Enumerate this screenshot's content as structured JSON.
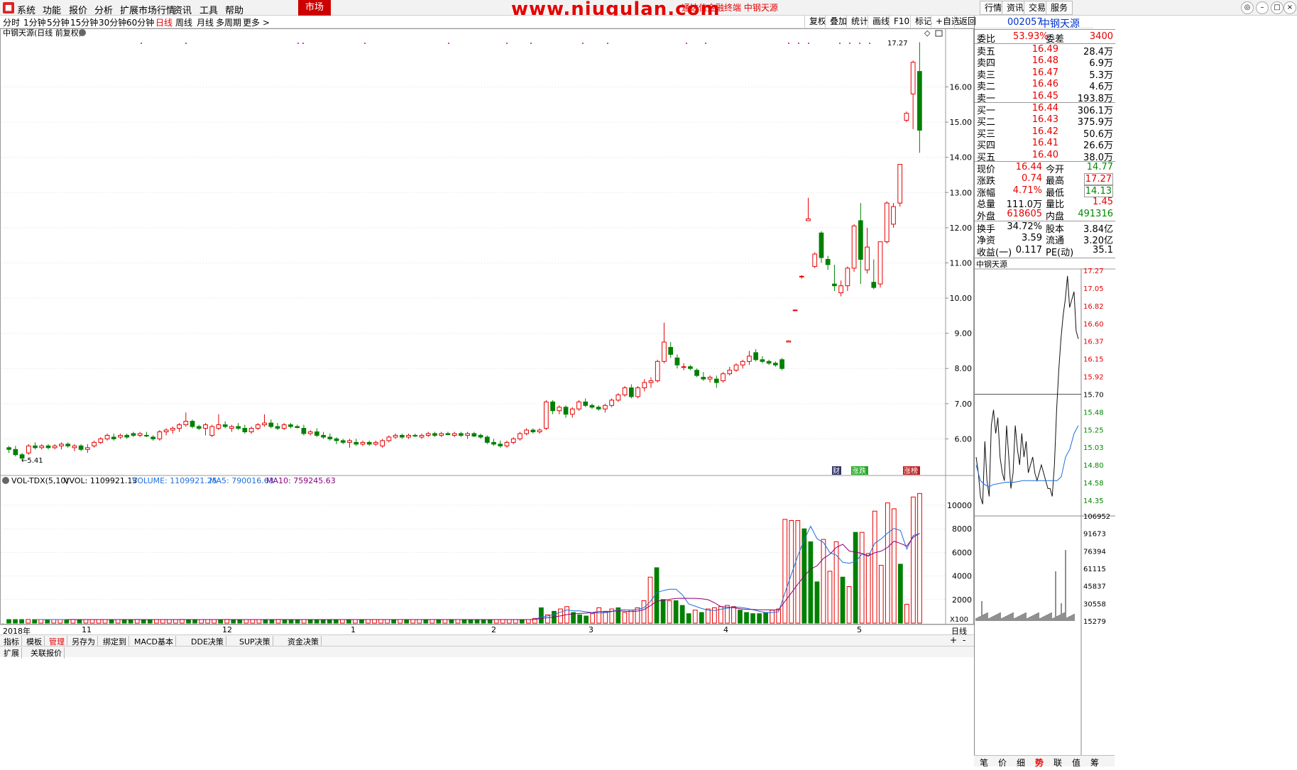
{
  "menu": {
    "items": [
      "系统",
      "功能",
      "报价",
      "分析",
      "扩展市场行情",
      "资讯",
      "工具",
      "帮助"
    ],
    "market_tab": "市场",
    "watermark": "www.niugulan.com",
    "watermark_sub": "通达信金融终端 中钢天源",
    "right_buttons": [
      "行情",
      "资讯",
      "交易",
      "服务"
    ]
  },
  "periods": {
    "items": [
      "分时",
      "1分钟",
      "5分钟",
      "15分钟",
      "30分钟",
      "60分钟",
      "日线",
      "周线",
      "月线",
      "多周期",
      "更多 >"
    ],
    "active": "日线",
    "tools": [
      "复权",
      "叠加",
      "统计",
      "画线",
      "F10",
      "标记",
      "+自选",
      "返回"
    ]
  },
  "chart": {
    "header": "中钢天源(日线 前复权)",
    "last_time": "17.27",
    "low_label": "5.41",
    "markers": [
      "财",
      "涨跌",
      "涨榜"
    ],
    "vol_header": {
      "indicator": "VOL-TDX(5,10)",
      "vvol": "VVOL: 1109921.13",
      "volume": "VOLUME: 1109921.25",
      "ma5": "MA5: 790016.63",
      "ma10": "MA10: 759245.63"
    },
    "x_labels": [
      "2018年",
      "11",
      "12",
      "1",
      "2",
      "3",
      "4",
      "5"
    ],
    "period_label": "日线",
    "x100": "X100",
    "colors": {
      "up": "#e60000",
      "down": "#008000",
      "ma5": "#1e6fdc",
      "ma10": "#8b0080"
    }
  },
  "chart_data": [
    {
      "type": "candlestick",
      "title": "中钢天源(日线 前复权)",
      "ylim": [
        5.0,
        17.3
      ],
      "y_ticks": [
        "6.00",
        "7.00",
        "8.00",
        "9.00",
        "10.00",
        "11.00",
        "12.00",
        "13.00",
        "14.00",
        "15.00",
        "16.00"
      ],
      "x_labels": [
        "2018年",
        "11",
        "12",
        "1",
        "2",
        "3",
        "4",
        "5"
      ],
      "ohlc": [
        [
          5.75,
          5.8,
          5.6,
          5.7
        ],
        [
          5.7,
          5.8,
          5.5,
          5.55
        ],
        [
          5.55,
          5.6,
          5.41,
          5.45
        ],
        [
          5.6,
          5.85,
          5.55,
          5.8
        ],
        [
          5.8,
          5.9,
          5.7,
          5.75
        ],
        [
          5.75,
          5.85,
          5.7,
          5.8
        ],
        [
          5.8,
          5.85,
          5.7,
          5.75
        ],
        [
          5.75,
          5.85,
          5.7,
          5.8
        ],
        [
          5.8,
          5.9,
          5.7,
          5.85
        ],
        [
          5.85,
          5.9,
          5.75,
          5.8
        ],
        [
          5.75,
          5.85,
          5.65,
          5.8
        ],
        [
          5.8,
          5.85,
          5.65,
          5.7
        ],
        [
          5.7,
          5.85,
          5.6,
          5.75
        ],
        [
          5.8,
          5.95,
          5.75,
          5.9
        ],
        [
          5.9,
          6.05,
          5.85,
          6.0
        ],
        [
          6.0,
          6.15,
          5.95,
          6.1
        ],
        [
          6.05,
          6.15,
          5.95,
          6.0
        ],
        [
          6.05,
          6.15,
          6.0,
          6.1
        ],
        [
          6.1,
          6.15,
          6.0,
          6.05
        ],
        [
          6.15,
          6.2,
          6.05,
          6.1
        ],
        [
          6.1,
          6.2,
          6.05,
          6.15
        ],
        [
          6.1,
          6.2,
          6.05,
          6.08
        ],
        [
          6.05,
          6.1,
          5.95,
          6.0
        ],
        [
          6.0,
          6.25,
          5.95,
          6.2
        ],
        [
          6.2,
          6.3,
          6.1,
          6.25
        ],
        [
          6.25,
          6.35,
          6.15,
          6.3
        ],
        [
          6.3,
          6.45,
          6.2,
          6.4
        ],
        [
          6.4,
          6.75,
          6.35,
          6.5
        ],
        [
          6.5,
          6.55,
          6.3,
          6.35
        ],
        [
          6.35,
          6.4,
          6.25,
          6.3
        ],
        [
          6.3,
          6.45,
          6.1,
          6.4
        ],
        [
          6.1,
          6.4,
          6.05,
          6.35
        ],
        [
          6.3,
          6.7,
          6.25,
          6.4
        ],
        [
          6.4,
          6.5,
          6.3,
          6.35
        ],
        [
          6.3,
          6.4,
          6.2,
          6.35
        ],
        [
          6.35,
          6.45,
          6.25,
          6.3
        ],
        [
          6.3,
          6.4,
          6.15,
          6.2
        ],
        [
          6.2,
          6.35,
          6.15,
          6.3
        ],
        [
          6.3,
          6.45,
          6.25,
          6.4
        ],
        [
          6.4,
          6.7,
          6.35,
          6.45
        ],
        [
          6.45,
          6.55,
          6.3,
          6.35
        ],
        [
          6.35,
          6.45,
          6.25,
          6.3
        ],
        [
          6.3,
          6.45,
          6.25,
          6.4
        ],
        [
          6.4,
          6.45,
          6.3,
          6.35
        ],
        [
          6.35,
          6.4,
          6.3,
          6.32
        ],
        [
          6.3,
          6.4,
          6.1,
          6.15
        ],
        [
          6.15,
          6.25,
          6.1,
          6.2
        ],
        [
          6.2,
          6.3,
          6.05,
          6.1
        ],
        [
          6.1,
          6.2,
          6.0,
          6.05
        ],
        [
          6.05,
          6.15,
          5.95,
          6.0
        ],
        [
          6.0,
          6.05,
          5.85,
          5.95
        ],
        [
          5.95,
          6.0,
          5.85,
          5.9
        ],
        [
          5.9,
          6.0,
          5.75,
          5.95
        ],
        [
          5.9,
          6.0,
          5.8,
          5.85
        ],
        [
          5.85,
          5.95,
          5.8,
          5.9
        ],
        [
          5.9,
          5.95,
          5.8,
          5.85
        ],
        [
          5.85,
          5.95,
          5.8,
          5.9
        ],
        [
          5.8,
          6.0,
          5.75,
          5.95
        ],
        [
          5.95,
          6.1,
          5.9,
          6.05
        ],
        [
          6.05,
          6.15,
          6.0,
          6.1
        ],
        [
          6.1,
          6.15,
          6.0,
          6.05
        ],
        [
          6.05,
          6.15,
          6.0,
          6.1
        ],
        [
          6.1,
          6.15,
          6.05,
          6.08
        ],
        [
          6.05,
          6.15,
          6.0,
          6.1
        ],
        [
          6.1,
          6.2,
          6.05,
          6.15
        ],
        [
          6.15,
          6.2,
          6.05,
          6.1
        ],
        [
          6.1,
          6.2,
          6.05,
          6.15
        ],
        [
          6.15,
          6.2,
          6.1,
          6.12
        ],
        [
          6.1,
          6.2,
          6.05,
          6.15
        ],
        [
          6.15,
          6.2,
          6.05,
          6.1
        ],
        [
          6.1,
          6.2,
          6.0,
          6.15
        ],
        [
          6.15,
          6.2,
          6.05,
          6.08
        ],
        [
          6.1,
          6.15,
          6.0,
          6.05
        ],
        [
          6.05,
          6.1,
          5.85,
          5.9
        ],
        [
          5.9,
          6.0,
          5.8,
          5.85
        ],
        [
          5.85,
          5.95,
          5.75,
          5.8
        ],
        [
          5.8,
          5.95,
          5.75,
          5.9
        ],
        [
          5.9,
          6.05,
          5.85,
          6.0
        ],
        [
          6.0,
          6.2,
          5.95,
          6.15
        ],
        [
          6.15,
          6.3,
          6.1,
          6.25
        ],
        [
          6.25,
          6.3,
          6.15,
          6.2
        ],
        [
          6.2,
          6.3,
          6.15,
          6.25
        ],
        [
          6.3,
          7.1,
          6.25,
          7.05
        ],
        [
          7.05,
          7.1,
          6.7,
          6.8
        ],
        [
          6.8,
          6.95,
          6.7,
          6.9
        ],
        [
          6.9,
          6.95,
          6.6,
          6.7
        ],
        [
          6.7,
          6.9,
          6.6,
          6.85
        ],
        [
          6.85,
          7.1,
          6.8,
          7.05
        ],
        [
          7.05,
          7.15,
          6.9,
          6.95
        ],
        [
          6.95,
          7.0,
          6.85,
          6.9
        ],
        [
          6.9,
          6.95,
          6.8,
          6.85
        ],
        [
          6.85,
          7.0,
          6.75,
          6.95
        ],
        [
          6.95,
          7.15,
          6.9,
          7.1
        ],
        [
          7.1,
          7.3,
          7.05,
          7.25
        ],
        [
          7.25,
          7.5,
          7.2,
          7.45
        ],
        [
          7.45,
          7.55,
          7.15,
          7.2
        ],
        [
          7.2,
          7.5,
          7.15,
          7.45
        ],
        [
          7.45,
          7.7,
          7.35,
          7.6
        ],
        [
          7.6,
          7.75,
          7.45,
          7.65
        ],
        [
          7.65,
          8.25,
          7.6,
          8.2
        ],
        [
          8.2,
          9.3,
          8.15,
          8.75
        ],
        [
          8.6,
          8.75,
          8.3,
          8.4
        ],
        [
          8.3,
          8.4,
          8.0,
          8.1
        ],
        [
          8.05,
          8.15,
          7.95,
          8.05
        ],
        [
          8.05,
          8.1,
          7.95,
          8.0
        ],
        [
          7.95,
          8.0,
          7.75,
          7.8
        ],
        [
          7.75,
          7.9,
          7.65,
          7.7
        ],
        [
          7.7,
          7.8,
          7.6,
          7.75
        ],
        [
          7.7,
          7.8,
          7.45,
          7.6
        ],
        [
          7.65,
          7.9,
          7.6,
          7.85
        ],
        [
          7.85,
          8.05,
          7.8,
          7.95
        ],
        [
          7.95,
          8.15,
          7.9,
          8.1
        ],
        [
          8.1,
          8.25,
          8.0,
          8.2
        ],
        [
          8.2,
          8.5,
          8.1,
          8.35
        ],
        [
          8.45,
          8.55,
          8.2,
          8.25
        ],
        [
          8.25,
          8.35,
          8.15,
          8.2
        ],
        [
          8.2,
          8.25,
          8.1,
          8.15
        ],
        [
          8.15,
          8.2,
          8.05,
          8.1
        ],
        [
          8.25,
          8.3,
          7.95,
          8.0
        ],
        [
          8.75,
          8.8,
          8.75,
          8.78
        ],
        [
          9.65,
          9.68,
          9.65,
          9.66
        ],
        [
          10.6,
          10.65,
          10.55,
          10.62
        ],
        [
          12.2,
          12.85,
          12.2,
          12.25
        ],
        [
          10.9,
          11.3,
          10.85,
          11.25
        ],
        [
          11.85,
          11.9,
          11.0,
          11.15
        ],
        [
          11.1,
          11.2,
          10.8,
          10.95
        ],
        [
          10.4,
          10.95,
          10.2,
          10.35
        ],
        [
          10.15,
          10.5,
          10.05,
          10.35
        ],
        [
          10.35,
          10.9,
          10.2,
          10.85
        ],
        [
          10.85,
          12.1,
          10.75,
          12.05
        ],
        [
          12.2,
          12.7,
          10.4,
          11.1
        ],
        [
          10.8,
          12.0,
          10.7,
          11.45
        ],
        [
          10.45,
          11.1,
          10.25,
          10.3
        ],
        [
          10.4,
          10.6,
          10.3,
          11.6
        ],
        [
          11.6,
          12.75,
          11.55,
          12.7
        ],
        [
          12.1,
          12.7,
          12.0,
          12.6
        ],
        [
          12.7,
          13.8,
          12.6,
          13.8
        ],
        [
          15.05,
          15.3,
          15.0,
          15.25
        ],
        [
          15.8,
          16.75,
          14.8,
          16.7
        ],
        [
          16.44,
          17.27,
          14.13,
          14.77
        ]
      ]
    },
    {
      "type": "bar",
      "title": "VOL-TDX(5,10)",
      "ylim": [
        0,
        11000
      ],
      "y_ticks": [
        "2000",
        "4000",
        "6000",
        "8000",
        "10000"
      ],
      "series": [
        {
          "name": "VOLUME",
          "values": [
            300,
            300,
            300,
            310,
            300,
            300,
            300,
            300,
            300,
            300,
            310,
            300,
            300,
            300,
            300,
            300,
            300,
            300,
            300,
            300,
            310,
            300,
            300,
            300,
            300,
            300,
            300,
            310,
            300,
            300,
            300,
            300,
            300,
            300,
            310,
            300,
            300,
            300,
            300,
            300,
            300,
            300,
            310,
            300,
            300,
            300,
            300,
            300,
            300,
            300,
            300,
            300,
            300,
            300,
            300,
            300,
            300,
            300,
            300,
            300,
            300,
            300,
            300,
            300,
            300,
            300,
            300,
            300,
            300,
            300,
            300,
            300,
            300,
            300,
            300,
            300,
            300,
            300,
            300,
            300,
            300,
            300,
            400,
            1300,
            700,
            1000,
            1200,
            1400,
            900,
            700,
            600,
            800,
            1300,
            1000,
            1200,
            1300,
            900,
            1100,
            1300,
            1900,
            3900,
            4700,
            2000,
            1900,
            1900,
            1500,
            800,
            1100,
            900,
            1200,
            1300,
            1400,
            1500,
            1400,
            1100,
            900,
            800,
            800,
            900,
            1100,
            1200,
            8800,
            8700,
            8700,
            8000,
            6900,
            3500,
            7100,
            4400,
            6900,
            3900,
            3100,
            7700,
            7700,
            5900,
            9500,
            4900,
            10200,
            9700,
            5000,
            1600,
            10700,
            11000
          ]
        },
        {
          "name": "MA5",
          "values": []
        },
        {
          "name": "MA10",
          "values": []
        }
      ]
    }
  ],
  "quote": {
    "code": "002057",
    "name": "中钢天源",
    "webi": {
      "label": "委比",
      "value": "53.93%",
      "label2": "委差",
      "value2": "3400"
    },
    "sell": [
      {
        "label": "卖五",
        "price": "16.49",
        "vol": "28.4万"
      },
      {
        "label": "卖四",
        "price": "16.48",
        "vol": "6.9万"
      },
      {
        "label": "卖三",
        "price": "16.47",
        "vol": "5.3万"
      },
      {
        "label": "卖二",
        "price": "16.46",
        "vol": "4.6万"
      },
      {
        "label": "卖一",
        "price": "16.45",
        "vol": "193.8万"
      }
    ],
    "buy": [
      {
        "label": "买一",
        "price": "16.44",
        "vol": "306.1万"
      },
      {
        "label": "买二",
        "price": "16.43",
        "vol": "375.9万"
      },
      {
        "label": "买三",
        "price": "16.42",
        "vol": "50.6万"
      },
      {
        "label": "买四",
        "price": "16.41",
        "vol": "26.6万"
      },
      {
        "label": "买五",
        "price": "16.40",
        "vol": "38.0万"
      }
    ],
    "stats": [
      {
        "l1": "现价",
        "v1": "16.44",
        "l2": "今开",
        "v2": "14.77",
        "c1": "red",
        "c2": "green"
      },
      {
        "l1": "涨跌",
        "v1": "0.74",
        "l2": "最高",
        "v2": "17.27",
        "c1": "red",
        "c2": "red"
      },
      {
        "l1": "涨幅",
        "v1": "4.71%",
        "l2": "最低",
        "v2": "14.13",
        "c1": "red",
        "c2": "green"
      },
      {
        "l1": "总量",
        "v1": "111.0万",
        "l2": "量比",
        "v2": "1.45",
        "c1": "black",
        "c2": "red"
      },
      {
        "l1": "外盘",
        "v1": "618605",
        "l2": "内盘",
        "v2": "491316",
        "c1": "red",
        "c2": "green"
      }
    ],
    "stats2": [
      {
        "l1": "换手",
        "v1": "34.72%",
        "l2": "股本",
        "v2": "3.84亿"
      },
      {
        "l1": "净资",
        "v1": "3.59",
        "l2": "流通",
        "v2": "3.20亿"
      },
      {
        "l1": "收益(一)",
        "v1": "0.117",
        "l2": "PE(动)",
        "v2": "35.1"
      }
    ]
  },
  "mini_chart": {
    "title": "中钢天源",
    "price_labels": [
      "17.27",
      "17.05",
      "16.82",
      "16.60",
      "16.37",
      "16.15",
      "15.92",
      "15.70",
      "15.48",
      "15.25",
      "15.03",
      "14.80",
      "14.58",
      "14.35"
    ],
    "vol_labels": [
      "106952",
      "91673",
      "76394",
      "61115",
      "45837",
      "30558",
      "15279"
    ]
  },
  "bottom": {
    "row1": [
      "指标",
      "模板",
      "管理",
      "另存为",
      "绑定到",
      "MACD基本",
      "DDE决策",
      "SUP决策",
      "资金决策"
    ],
    "row1_active": "管理",
    "row2": [
      "扩展",
      "关联报价"
    ],
    "mini_tabs": [
      "笔",
      "价",
      "细",
      "势",
      "联",
      "值",
      "筹"
    ],
    "mini_active": "势"
  }
}
